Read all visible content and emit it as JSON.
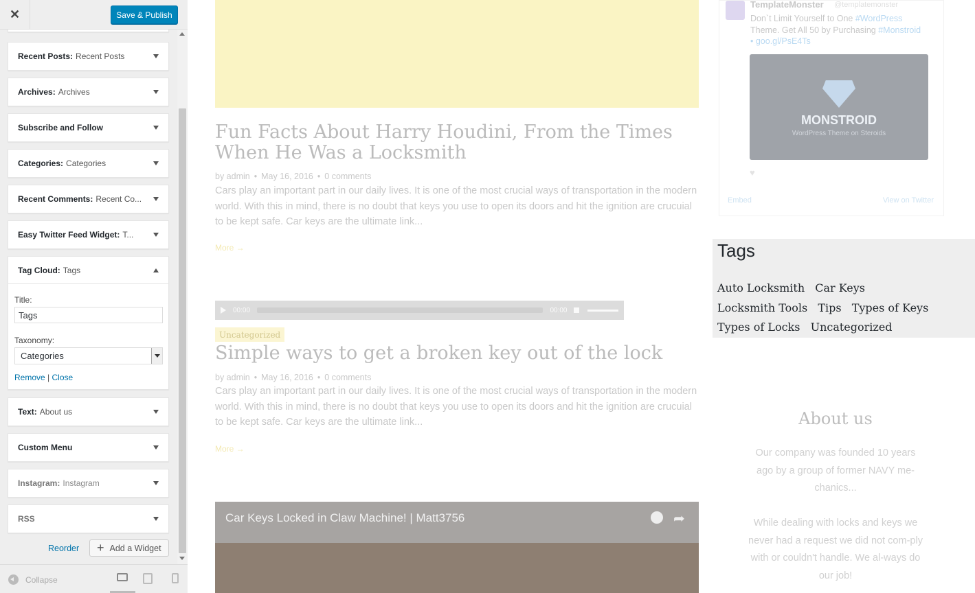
{
  "customizer": {
    "close_glyph": "✕",
    "publish_label": "Save & Publish",
    "widgets": [
      {
        "name": "Recent Posts:",
        "sub": "Recent Posts"
      },
      {
        "name": "Archives:",
        "sub": "Archives"
      },
      {
        "name": "Subscribe and Follow",
        "sub": ""
      },
      {
        "name": "Categories:",
        "sub": "Categories"
      },
      {
        "name": "Recent Comments:",
        "sub": "Recent Co..."
      },
      {
        "name": "Easy Twitter Feed Widget:",
        "sub": "T..."
      },
      {
        "name": "Tag Cloud:",
        "sub": "Tags"
      },
      {
        "name": "Text:",
        "sub": "About us"
      },
      {
        "name": "Custom Menu",
        "sub": ""
      },
      {
        "name": "Instagram:",
        "sub": "Instagram"
      },
      {
        "name": "RSS",
        "sub": ""
      }
    ],
    "tag_cloud_form": {
      "title_label": "Title:",
      "title_value": "Tags",
      "taxonomy_label": "Taxonomy:",
      "taxonomy_value": "Categories",
      "remove_label": "Remove",
      "separator": "|",
      "close_label": "Close"
    },
    "reorder_label": "Reorder",
    "add_widget_label": "Add a Widget",
    "collapse_label": "Collapse"
  },
  "preview": {
    "posts": [
      {
        "title": "Fun Facts About Harry Houdini, From the Times When He Was a Locksmith",
        "author": "by admin",
        "date": "May 16, 2016",
        "comments": "0 comments",
        "excerpt": "Cars play an important part in our daily lives. It is one of the most crucial ways of transportation in the modern world. With this in mind, there is no doubt that keys you use to open its doors and hit the ignition are crucuial to be kept safe. Car keys are the ultimate link...",
        "more": "More →"
      },
      {
        "category": "Uncategorized",
        "title": "Simple ways to get a broken key out of the lock",
        "author": "by admin",
        "date": "May 16, 2016",
        "comments": "0 comments",
        "excerpt": "Cars play an important part in our daily lives. It is one of the most crucial ways of transportation in the modern world. With this in mind, there is no doubt that keys you use to open its doors and hit the ignition are crucuial to be kept safe. Car keys are the ultimate link...",
        "more": "More →"
      }
    ],
    "audio": {
      "current": "00:00",
      "duration": "00:00"
    },
    "video_title": "Car Keys Locked in Claw Machine! | Matt3756",
    "tweet": {
      "name": "TemplateMonster",
      "handle": "@templatemonster",
      "text_plain": "Don`t Limit Yourself to One ",
      "text_tag1": "#WordPress",
      "text_mid": " Theme. Get All 50 by Purchasing ",
      "text_tag2": "#Monstroid • goo.gl/PsE4Ts",
      "brand": "MONSTROID",
      "brand_tag": "WordPress Theme on Steroids",
      "embed_label": "Embed",
      "view_label": "View on Twitter"
    },
    "tags_widget": {
      "title": "Tags",
      "tags": [
        "Auto Locksmith",
        "Car Keys",
        "Locksmith Tools",
        "Tips",
        "Types of Keys",
        "Types of Locks",
        "Uncategorized"
      ]
    },
    "about": {
      "title": "About us",
      "p1": "Our company was founded 10 years ago by a group of former NAVY me-chanics...",
      "p2": "While dealing with locks and keys we never had a request we did not com-ply with or couldn't handle. We al-ways do our job!"
    }
  }
}
